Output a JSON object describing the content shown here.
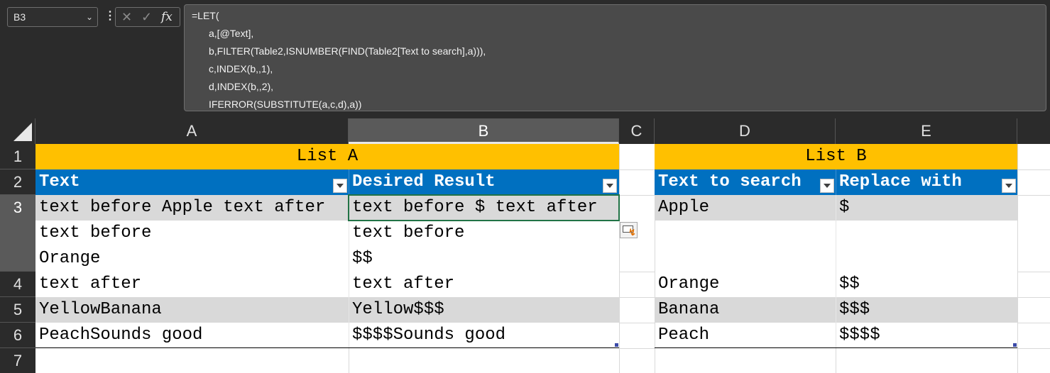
{
  "name_box": {
    "value": "B3",
    "icon": "chevron-down"
  },
  "formula_bar": {
    "cancel_icon": "✕",
    "enter_icon": "✓",
    "fx_label": "fx",
    "lines": [
      "=LET(",
      "a,[@Text],",
      "b,FILTER(Table2,ISNUMBER(FIND(Table2[Text to search],a))),",
      "c,INDEX(b,,1),",
      "d,INDEX(b,,2),",
      "IFERROR(SUBSTITUTE(a,c,d),a))"
    ]
  },
  "grid": {
    "columns": [
      "A",
      "B",
      "C",
      "D",
      "E"
    ],
    "rows": [
      "1",
      "2",
      "3",
      "4",
      "5",
      "6",
      "7"
    ],
    "selected_cell": "B3"
  },
  "list_a": {
    "title": "List A",
    "headers": [
      "Text",
      "Desired Result"
    ],
    "rows": [
      [
        "text before Apple text after",
        "text before $ text after"
      ],
      [
        "text before",
        "text before"
      ],
      [
        "Orange",
        "$$"
      ],
      [
        "text after",
        "text after"
      ],
      [
        "YellowBanana",
        "Yellow$$$"
      ],
      [
        "PeachSounds good",
        "$$$$Sounds good"
      ]
    ]
  },
  "list_b": {
    "title": "List B",
    "headers": [
      "Text to search",
      "Replace with"
    ],
    "rows": [
      [
        "Apple",
        "$"
      ],
      [
        "",
        ""
      ],
      [
        "",
        ""
      ],
      [
        "Orange",
        "$$"
      ],
      [
        "Banana",
        "$$$"
      ],
      [
        "Peach",
        "$$$$"
      ]
    ]
  },
  "colors": {
    "title_band": "#ffc000",
    "table_header": "#0070c0",
    "band_row": "#d9d9d9",
    "selection": "#217346"
  }
}
